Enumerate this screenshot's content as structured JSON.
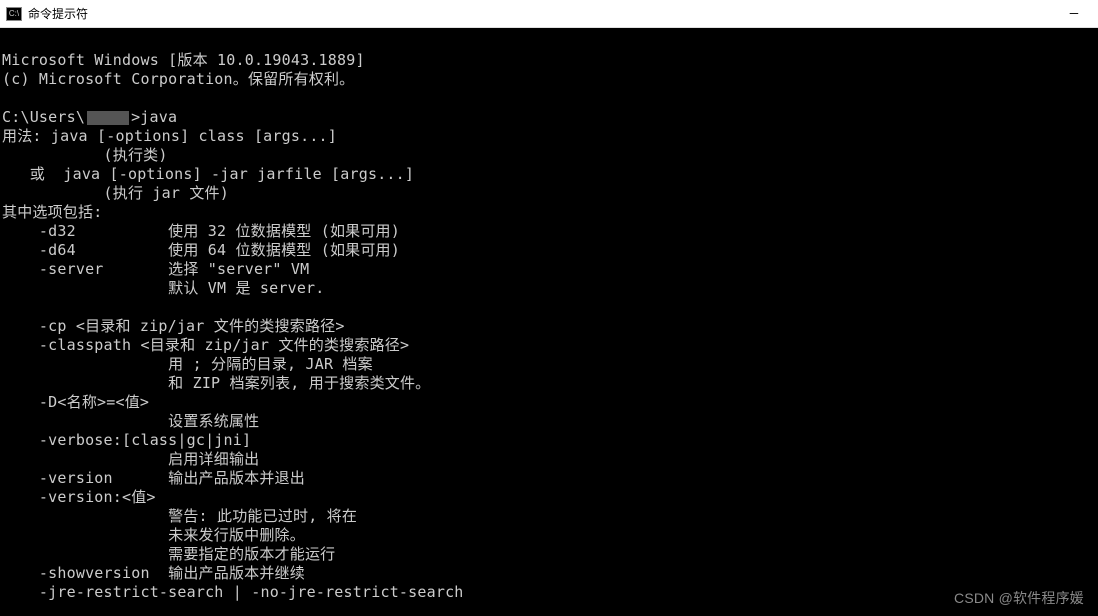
{
  "titlebar": {
    "icon_label": "C:\\",
    "title": "命令提示符",
    "minimize": "—"
  },
  "terminal": {
    "lines": {
      "l1": "Microsoft Windows [版本 10.0.19043.1889]",
      "l2": "(c) Microsoft Corporation。保留所有权利。",
      "l3": "",
      "l4a": "C:\\Users\\",
      "l4b": ">java",
      "l5": "用法: java [-options] class [args...]",
      "l6": "           (执行类)",
      "l7": "   或  java [-options] -jar jarfile [args...]",
      "l8": "           (执行 jar 文件)",
      "l9": "其中选项包括:",
      "l10": "    -d32          使用 32 位数据模型 (如果可用)",
      "l11": "    -d64          使用 64 位数据模型 (如果可用)",
      "l12": "    -server       选择 \"server\" VM",
      "l13": "                  默认 VM 是 server.",
      "l14": "",
      "l15": "    -cp <目录和 zip/jar 文件的类搜索路径>",
      "l16": "    -classpath <目录和 zip/jar 文件的类搜索路径>",
      "l17": "                  用 ; 分隔的目录, JAR 档案",
      "l18": "                  和 ZIP 档案列表, 用于搜索类文件。",
      "l19": "    -D<名称>=<值>",
      "l20": "                  设置系统属性",
      "l21": "    -verbose:[class|gc|jni]",
      "l22": "                  启用详细输出",
      "l23": "    -version      输出产品版本并退出",
      "l24": "    -version:<值>",
      "l25": "                  警告: 此功能已过时, 将在",
      "l26": "                  未来发行版中删除。",
      "l27": "                  需要指定的版本才能运行",
      "l28": "    -showversion  输出产品版本并继续",
      "l29": "    -jre-restrict-search | -no-jre-restrict-search"
    }
  },
  "watermark": "CSDN @软件程序媛"
}
